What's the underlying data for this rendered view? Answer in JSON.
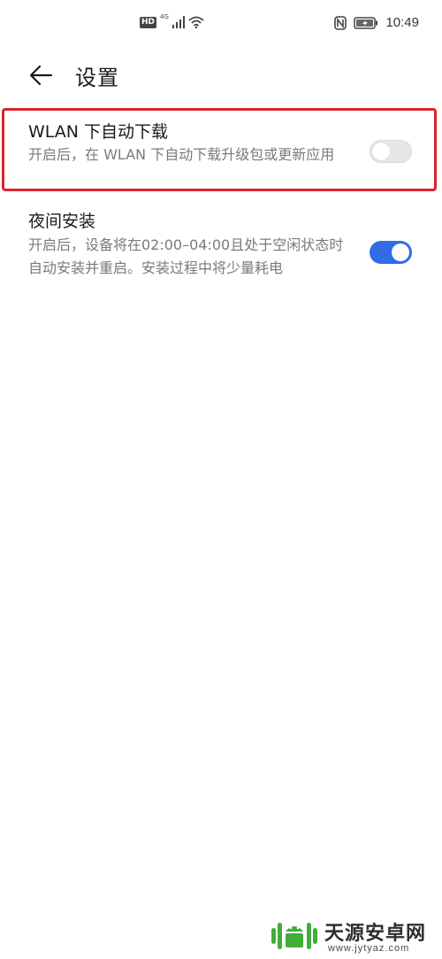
{
  "status_bar": {
    "hd_label": "HD",
    "network_type": "4G",
    "time": "10:49",
    "icons": [
      "signal-icon",
      "wifi-icon",
      "nfc-icon",
      "battery-charging-icon"
    ]
  },
  "header": {
    "title": "设置",
    "back_icon": "arrow-left-icon"
  },
  "settings": [
    {
      "title": "WLAN 下自动下载",
      "description": "开启后，在 WLAN 下自动下载升级包或更新应用",
      "enabled": false,
      "highlighted": true
    },
    {
      "title": "夜间安装",
      "description": "开启后，设备将在02:00–04:00且处于空闲状态时自动安装并重启。安装过程中将少量耗电",
      "enabled": true,
      "highlighted": false
    }
  ],
  "colors": {
    "toggle_on": "#2f6ce6",
    "toggle_off": "#e6e6e6",
    "highlight_border": "#d9252b",
    "watermark_green": "#3fae3a"
  },
  "watermark": {
    "name": "天源安卓网",
    "url": "www.jytyaz.com"
  }
}
